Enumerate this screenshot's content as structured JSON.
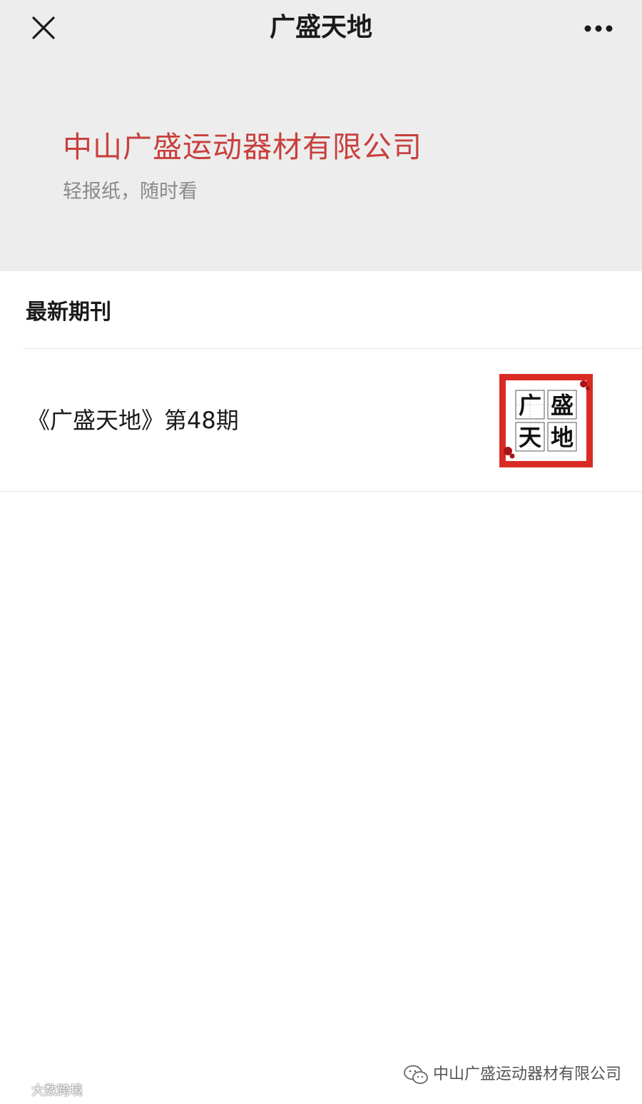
{
  "nav": {
    "title": "广盛天地",
    "close_icon": "close-icon",
    "more_icon": "more-icon"
  },
  "profile": {
    "name": "中山广盛运动器材有限公司",
    "slogan": "轻报纸，随时看"
  },
  "latest": {
    "section_title": "最新期刊",
    "items": [
      {
        "title": "《广盛天地》第48期",
        "thumbnail_chars": [
          "广",
          "盛",
          "天",
          "地"
        ]
      }
    ]
  },
  "footer": {
    "source_icon": "wechat-icon",
    "source": "中山广盛运动器材有限公司"
  },
  "watermark": {
    "text": "大数跨境"
  },
  "colors": {
    "header_bg": "#ededed",
    "accent_red": "#c8403d",
    "thumb_border": "#d92b23"
  }
}
